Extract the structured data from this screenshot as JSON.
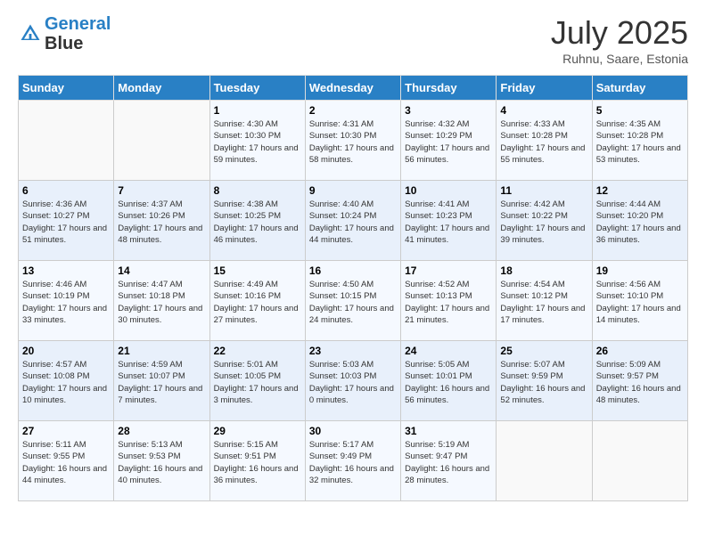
{
  "header": {
    "logo_line1": "General",
    "logo_line2": "Blue",
    "month": "July 2025",
    "location": "Ruhnu, Saare, Estonia"
  },
  "weekdays": [
    "Sunday",
    "Monday",
    "Tuesday",
    "Wednesday",
    "Thursday",
    "Friday",
    "Saturday"
  ],
  "weeks": [
    [
      {
        "day": "",
        "sunrise": "",
        "sunset": "",
        "daylight": ""
      },
      {
        "day": "",
        "sunrise": "",
        "sunset": "",
        "daylight": ""
      },
      {
        "day": "1",
        "sunrise": "Sunrise: 4:30 AM",
        "sunset": "Sunset: 10:30 PM",
        "daylight": "Daylight: 17 hours and 59 minutes."
      },
      {
        "day": "2",
        "sunrise": "Sunrise: 4:31 AM",
        "sunset": "Sunset: 10:30 PM",
        "daylight": "Daylight: 17 hours and 58 minutes."
      },
      {
        "day": "3",
        "sunrise": "Sunrise: 4:32 AM",
        "sunset": "Sunset: 10:29 PM",
        "daylight": "Daylight: 17 hours and 56 minutes."
      },
      {
        "day": "4",
        "sunrise": "Sunrise: 4:33 AM",
        "sunset": "Sunset: 10:28 PM",
        "daylight": "Daylight: 17 hours and 55 minutes."
      },
      {
        "day": "5",
        "sunrise": "Sunrise: 4:35 AM",
        "sunset": "Sunset: 10:28 PM",
        "daylight": "Daylight: 17 hours and 53 minutes."
      }
    ],
    [
      {
        "day": "6",
        "sunrise": "Sunrise: 4:36 AM",
        "sunset": "Sunset: 10:27 PM",
        "daylight": "Daylight: 17 hours and 51 minutes."
      },
      {
        "day": "7",
        "sunrise": "Sunrise: 4:37 AM",
        "sunset": "Sunset: 10:26 PM",
        "daylight": "Daylight: 17 hours and 48 minutes."
      },
      {
        "day": "8",
        "sunrise": "Sunrise: 4:38 AM",
        "sunset": "Sunset: 10:25 PM",
        "daylight": "Daylight: 17 hours and 46 minutes."
      },
      {
        "day": "9",
        "sunrise": "Sunrise: 4:40 AM",
        "sunset": "Sunset: 10:24 PM",
        "daylight": "Daylight: 17 hours and 44 minutes."
      },
      {
        "day": "10",
        "sunrise": "Sunrise: 4:41 AM",
        "sunset": "Sunset: 10:23 PM",
        "daylight": "Daylight: 17 hours and 41 minutes."
      },
      {
        "day": "11",
        "sunrise": "Sunrise: 4:42 AM",
        "sunset": "Sunset: 10:22 PM",
        "daylight": "Daylight: 17 hours and 39 minutes."
      },
      {
        "day": "12",
        "sunrise": "Sunrise: 4:44 AM",
        "sunset": "Sunset: 10:20 PM",
        "daylight": "Daylight: 17 hours and 36 minutes."
      }
    ],
    [
      {
        "day": "13",
        "sunrise": "Sunrise: 4:46 AM",
        "sunset": "Sunset: 10:19 PM",
        "daylight": "Daylight: 17 hours and 33 minutes."
      },
      {
        "day": "14",
        "sunrise": "Sunrise: 4:47 AM",
        "sunset": "Sunset: 10:18 PM",
        "daylight": "Daylight: 17 hours and 30 minutes."
      },
      {
        "day": "15",
        "sunrise": "Sunrise: 4:49 AM",
        "sunset": "Sunset: 10:16 PM",
        "daylight": "Daylight: 17 hours and 27 minutes."
      },
      {
        "day": "16",
        "sunrise": "Sunrise: 4:50 AM",
        "sunset": "Sunset: 10:15 PM",
        "daylight": "Daylight: 17 hours and 24 minutes."
      },
      {
        "day": "17",
        "sunrise": "Sunrise: 4:52 AM",
        "sunset": "Sunset: 10:13 PM",
        "daylight": "Daylight: 17 hours and 21 minutes."
      },
      {
        "day": "18",
        "sunrise": "Sunrise: 4:54 AM",
        "sunset": "Sunset: 10:12 PM",
        "daylight": "Daylight: 17 hours and 17 minutes."
      },
      {
        "day": "19",
        "sunrise": "Sunrise: 4:56 AM",
        "sunset": "Sunset: 10:10 PM",
        "daylight": "Daylight: 17 hours and 14 minutes."
      }
    ],
    [
      {
        "day": "20",
        "sunrise": "Sunrise: 4:57 AM",
        "sunset": "Sunset: 10:08 PM",
        "daylight": "Daylight: 17 hours and 10 minutes."
      },
      {
        "day": "21",
        "sunrise": "Sunrise: 4:59 AM",
        "sunset": "Sunset: 10:07 PM",
        "daylight": "Daylight: 17 hours and 7 minutes."
      },
      {
        "day": "22",
        "sunrise": "Sunrise: 5:01 AM",
        "sunset": "Sunset: 10:05 PM",
        "daylight": "Daylight: 17 hours and 3 minutes."
      },
      {
        "day": "23",
        "sunrise": "Sunrise: 5:03 AM",
        "sunset": "Sunset: 10:03 PM",
        "daylight": "Daylight: 17 hours and 0 minutes."
      },
      {
        "day": "24",
        "sunrise": "Sunrise: 5:05 AM",
        "sunset": "Sunset: 10:01 PM",
        "daylight": "Daylight: 16 hours and 56 minutes."
      },
      {
        "day": "25",
        "sunrise": "Sunrise: 5:07 AM",
        "sunset": "Sunset: 9:59 PM",
        "daylight": "Daylight: 16 hours and 52 minutes."
      },
      {
        "day": "26",
        "sunrise": "Sunrise: 5:09 AM",
        "sunset": "Sunset: 9:57 PM",
        "daylight": "Daylight: 16 hours and 48 minutes."
      }
    ],
    [
      {
        "day": "27",
        "sunrise": "Sunrise: 5:11 AM",
        "sunset": "Sunset: 9:55 PM",
        "daylight": "Daylight: 16 hours and 44 minutes."
      },
      {
        "day": "28",
        "sunrise": "Sunrise: 5:13 AM",
        "sunset": "Sunset: 9:53 PM",
        "daylight": "Daylight: 16 hours and 40 minutes."
      },
      {
        "day": "29",
        "sunrise": "Sunrise: 5:15 AM",
        "sunset": "Sunset: 9:51 PM",
        "daylight": "Daylight: 16 hours and 36 minutes."
      },
      {
        "day": "30",
        "sunrise": "Sunrise: 5:17 AM",
        "sunset": "Sunset: 9:49 PM",
        "daylight": "Daylight: 16 hours and 32 minutes."
      },
      {
        "day": "31",
        "sunrise": "Sunrise: 5:19 AM",
        "sunset": "Sunset: 9:47 PM",
        "daylight": "Daylight: 16 hours and 28 minutes."
      },
      {
        "day": "",
        "sunrise": "",
        "sunset": "",
        "daylight": ""
      },
      {
        "day": "",
        "sunrise": "",
        "sunset": "",
        "daylight": ""
      }
    ]
  ]
}
